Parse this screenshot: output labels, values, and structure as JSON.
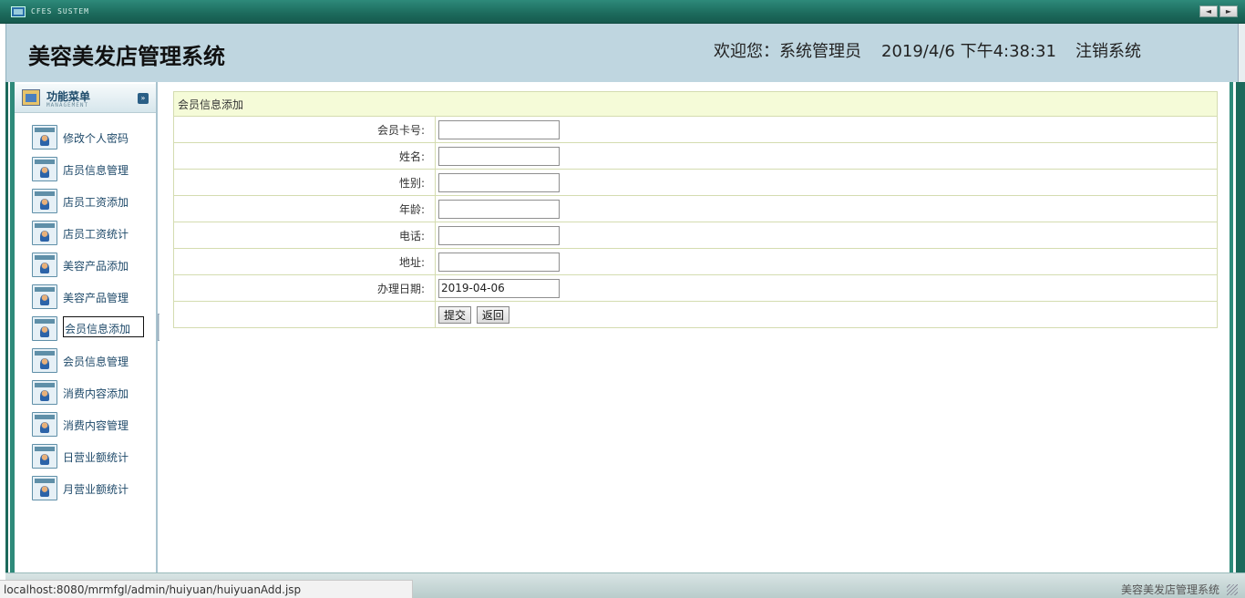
{
  "window": {
    "system_label": "CFES SUSTEM",
    "nav_prev": "◄",
    "nav_next": "►"
  },
  "header": {
    "title": "美容美发店管理系统",
    "welcome": "欢迎您：系统管理员",
    "datetime": "2019/4/6 下午4:38:31",
    "logout": "注销系统"
  },
  "sidebar": {
    "menu_title": "功能菜单",
    "menu_subtitle": "MANAGEMENT",
    "items": [
      {
        "label": "修改个人密码"
      },
      {
        "label": "店员信息管理"
      },
      {
        "label": "店员工资添加"
      },
      {
        "label": "店员工资统计"
      },
      {
        "label": "美容产品添加"
      },
      {
        "label": "美容产品管理"
      },
      {
        "label": "会员信息添加",
        "active": true
      },
      {
        "label": "会员信息管理"
      },
      {
        "label": "消费内容添加"
      },
      {
        "label": "消费内容管理"
      },
      {
        "label": "日营业额统计"
      },
      {
        "label": "月营业额统计"
      }
    ]
  },
  "form": {
    "caption": "会员信息添加",
    "fields": [
      {
        "label": "会员卡号:",
        "value": ""
      },
      {
        "label": "姓名:",
        "value": ""
      },
      {
        "label": "性别:",
        "value": ""
      },
      {
        "label": "年龄:",
        "value": ""
      },
      {
        "label": "电话:",
        "value": ""
      },
      {
        "label": "地址:",
        "value": ""
      },
      {
        "label": "办理日期:",
        "value": "2019-04-06"
      }
    ],
    "submit_label": "提交",
    "back_label": "返回"
  },
  "footer": {
    "brand": "美容美发店管理系统"
  },
  "statusbar": {
    "url": "localhost:8080/mrmfgl/admin/huiyuan/huiyuanAdd.jsp"
  }
}
